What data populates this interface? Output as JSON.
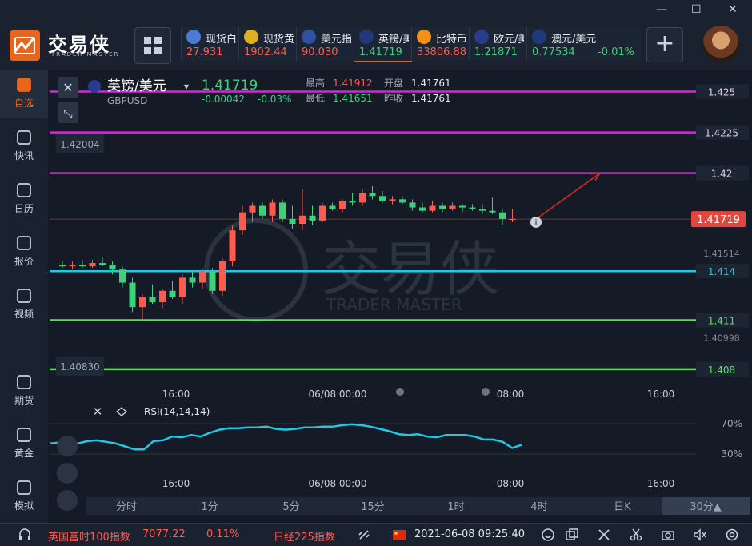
{
  "window": {
    "minimize": "—",
    "maximize": "☐",
    "close": "✕"
  },
  "logo": {
    "text": "交易侠",
    "sub": "TRADER MASTER"
  },
  "tickers": [
    {
      "name": "现货白银",
      "value": "27.931",
      "color": "#ff5a4e"
    },
    {
      "name": "现货黄金",
      "value": "1902.44",
      "color": "#ff5a4e"
    },
    {
      "name": "美元指数",
      "value": "90.030",
      "color": "#ff5a4e"
    },
    {
      "name": "英镑/美元",
      "value": "1.41719",
      "color": "#3fd17a"
    },
    {
      "name": "比特币",
      "value": "33806.88",
      "color": "#ff5a4e"
    },
    {
      "name": "欧元/美元",
      "value": "1.21871",
      "color": "#3fd17a"
    },
    {
      "name": "澳元/美元",
      "value": "0.77534",
      "change": "-0.01%",
      "color": "#3fd17a"
    }
  ],
  "add_label": "+",
  "sidebar": [
    {
      "label": "自选",
      "icon": "bookmark-icon",
      "active": true
    },
    {
      "label": "快讯",
      "icon": "news-icon"
    },
    {
      "label": "日历",
      "icon": "calendar-icon"
    },
    {
      "label": "报价",
      "icon": "quote-chart-icon"
    },
    {
      "label": "视频",
      "icon": "video-icon"
    },
    {
      "label": "期货",
      "icon": "futures-icon"
    },
    {
      "label": "黄金",
      "icon": "gold-icon"
    },
    {
      "label": "模拟",
      "icon": "simulate-icon"
    }
  ],
  "symbol": {
    "name": "英镑/美元",
    "code": "GBPUSD",
    "price": "1.41719",
    "change": "-0.00042",
    "change_pct": "-0.03%",
    "high_label": "最高",
    "high": "1.41912",
    "low_label": "最低",
    "low": "1.41651",
    "open_label": "开盘",
    "open": "1.41761",
    "prev_label": "昨收",
    "prev": "1.41761"
  },
  "watermark": {
    "text": "交易侠",
    "sub": "TRADER MASTER"
  },
  "rsi": {
    "label": "RSI(14,14,14)",
    "levels": [
      "70%",
      "30%"
    ]
  },
  "x_labels": [
    "16:00",
    "06/08 00:00",
    "08:00",
    "16:00"
  ],
  "timeframes": [
    "分时",
    "1分",
    "5分",
    "15分",
    "1时",
    "4时",
    "日K",
    "30分▲"
  ],
  "active_timeframe": 7,
  "colors": {
    "up": "#ff5a4e",
    "down": "#3fd17a",
    "magenta": "#e21ee2",
    "cyan": "#22c7e3",
    "green_line": "#5ee05a",
    "rsi": "#22c7e3"
  },
  "chart_data": {
    "type": "candlestick",
    "series_name": "GBPUSD",
    "y_range": [
      1.4076,
      1.4262
    ],
    "y_tick_labels": [
      "1.425",
      "1.4225",
      "1.42",
      "1.41719",
      "1.41514",
      "1.414",
      "1.411",
      "1.40998",
      "1.408"
    ],
    "left_price_tags": [
      "1.42004",
      "1.40830"
    ],
    "horizontal_lines": [
      {
        "value": 1.425,
        "color": "magenta"
      },
      {
        "value": 1.4225,
        "color": "magenta"
      },
      {
        "value": 1.42,
        "color": "magenta"
      },
      {
        "value": 1.414,
        "color": "cyan"
      },
      {
        "value": 1.411,
        "color": "green_line"
      },
      {
        "value": 1.408,
        "color": "green_line"
      }
    ],
    "current_price": 1.41719,
    "candles": [
      {
        "o": 1.4144,
        "h": 1.4146,
        "l": 1.4142,
        "c": 1.4143
      },
      {
        "o": 1.4143,
        "h": 1.4146,
        "l": 1.4141,
        "c": 1.4144
      },
      {
        "o": 1.4144,
        "h": 1.4147,
        "l": 1.4142,
        "c": 1.4143
      },
      {
        "o": 1.4143,
        "h": 1.4147,
        "l": 1.4142,
        "c": 1.4145
      },
      {
        "o": 1.4145,
        "h": 1.4149,
        "l": 1.4143,
        "c": 1.4144
      },
      {
        "o": 1.4144,
        "h": 1.4146,
        "l": 1.4138,
        "c": 1.4141
      },
      {
        "o": 1.4141,
        "h": 1.4143,
        "l": 1.413,
        "c": 1.4133
      },
      {
        "o": 1.4133,
        "h": 1.4136,
        "l": 1.4115,
        "c": 1.4118
      },
      {
        "o": 1.4118,
        "h": 1.4126,
        "l": 1.411,
        "c": 1.4124
      },
      {
        "o": 1.4124,
        "h": 1.4132,
        "l": 1.412,
        "c": 1.4121
      },
      {
        "o": 1.4121,
        "h": 1.4129,
        "l": 1.4117,
        "c": 1.4128
      },
      {
        "o": 1.4128,
        "h": 1.4134,
        "l": 1.4123,
        "c": 1.4124
      },
      {
        "o": 1.4124,
        "h": 1.4138,
        "l": 1.412,
        "c": 1.4136
      },
      {
        "o": 1.4136,
        "h": 1.414,
        "l": 1.413,
        "c": 1.4133
      },
      {
        "o": 1.4133,
        "h": 1.4142,
        "l": 1.4129,
        "c": 1.414
      },
      {
        "o": 1.414,
        "h": 1.4142,
        "l": 1.4126,
        "c": 1.4128
      },
      {
        "o": 1.4128,
        "h": 1.4148,
        "l": 1.4125,
        "c": 1.4146
      },
      {
        "o": 1.4146,
        "h": 1.4168,
        "l": 1.4143,
        "c": 1.4165
      },
      {
        "o": 1.4165,
        "h": 1.418,
        "l": 1.4162,
        "c": 1.4176
      },
      {
        "o": 1.4176,
        "h": 1.4182,
        "l": 1.417,
        "c": 1.418
      },
      {
        "o": 1.418,
        "h": 1.4182,
        "l": 1.4172,
        "c": 1.4174
      },
      {
        "o": 1.4174,
        "h": 1.4184,
        "l": 1.417,
        "c": 1.4182
      },
      {
        "o": 1.4182,
        "h": 1.4184,
        "l": 1.417,
        "c": 1.4172
      },
      {
        "o": 1.4172,
        "h": 1.418,
        "l": 1.4166,
        "c": 1.4169
      },
      {
        "o": 1.4169,
        "h": 1.419,
        "l": 1.4165,
        "c": 1.4174
      },
      {
        "o": 1.4174,
        "h": 1.418,
        "l": 1.4168,
        "c": 1.4171
      },
      {
        "o": 1.4171,
        "h": 1.4182,
        "l": 1.417,
        "c": 1.418
      },
      {
        "o": 1.418,
        "h": 1.4182,
        "l": 1.4177,
        "c": 1.4178
      },
      {
        "o": 1.4178,
        "h": 1.4184,
        "l": 1.4176,
        "c": 1.4183
      },
      {
        "o": 1.4183,
        "h": 1.4188,
        "l": 1.418,
        "c": 1.4182
      },
      {
        "o": 1.4182,
        "h": 1.419,
        "l": 1.418,
        "c": 1.4188
      },
      {
        "o": 1.4188,
        "h": 1.4192,
        "l": 1.4184,
        "c": 1.4186
      },
      {
        "o": 1.4186,
        "h": 1.4189,
        "l": 1.4182,
        "c": 1.4183
      },
      {
        "o": 1.4183,
        "h": 1.4186,
        "l": 1.4181,
        "c": 1.4184
      },
      {
        "o": 1.4184,
        "h": 1.4186,
        "l": 1.4181,
        "c": 1.4182
      },
      {
        "o": 1.4182,
        "h": 1.4184,
        "l": 1.4177,
        "c": 1.4179
      },
      {
        "o": 1.4179,
        "h": 1.4182,
        "l": 1.4176,
        "c": 1.4177
      },
      {
        "o": 1.4177,
        "h": 1.4183,
        "l": 1.4176,
        "c": 1.418
      },
      {
        "o": 1.418,
        "h": 1.4182,
        "l": 1.4176,
        "c": 1.4178
      },
      {
        "o": 1.4178,
        "h": 1.4182,
        "l": 1.4177,
        "c": 1.418
      },
      {
        "o": 1.418,
        "h": 1.4181,
        "l": 1.4176,
        "c": 1.4179
      },
      {
        "o": 1.4179,
        "h": 1.4181,
        "l": 1.4177,
        "c": 1.4178
      },
      {
        "o": 1.4178,
        "h": 1.4181,
        "l": 1.4175,
        "c": 1.4177
      },
      {
        "o": 1.4177,
        "h": 1.4185,
        "l": 1.4175,
        "c": 1.4176
      },
      {
        "o": 1.4176,
        "h": 1.4178,
        "l": 1.4168,
        "c": 1.4172
      },
      {
        "o": 1.4172,
        "h": 1.4178,
        "l": 1.417,
        "c": 1.4172
      }
    ],
    "rsi_values": [
      44,
      45,
      43,
      44,
      47,
      48,
      46,
      44,
      40,
      36,
      36,
      47,
      48,
      53,
      52,
      55,
      53,
      58,
      62,
      64,
      64,
      65,
      65,
      66,
      63,
      62,
      63,
      65,
      65,
      66,
      66,
      68,
      69,
      68,
      66,
      63,
      60,
      56,
      55,
      56,
      53,
      52,
      55,
      55,
      55,
      53,
      49,
      49,
      46,
      38,
      42
    ]
  },
  "status": {
    "index1_name": "英国富时100指数",
    "index1_value": "7077.22",
    "index1_change": "0.11%",
    "index2_name": "日经225指数",
    "datetime": "2021-06-08 09:25:40"
  }
}
